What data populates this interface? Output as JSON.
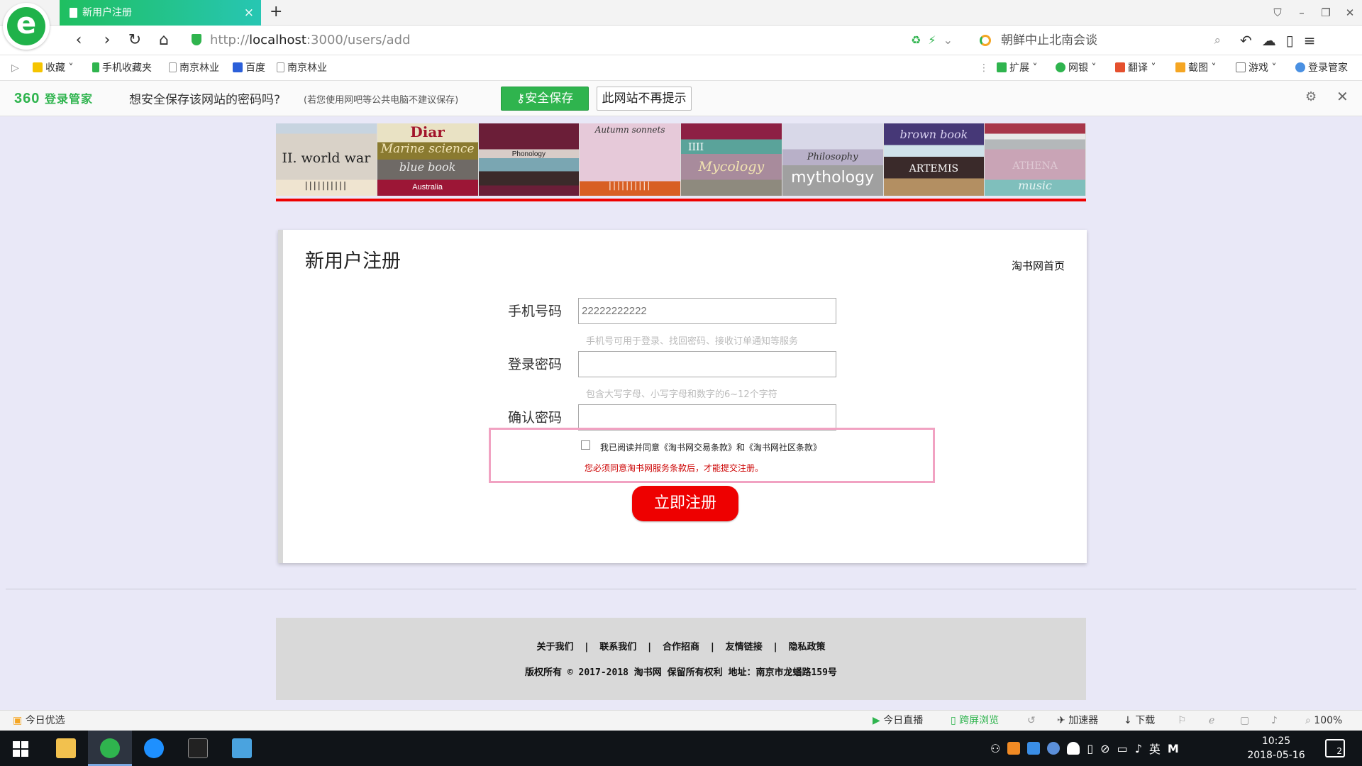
{
  "browser": {
    "tab_title": "新用户注册",
    "tab_close": "×",
    "new_tab": "+",
    "url_prefix": "http://",
    "url_host": "localhost",
    "url_rest": ":3000/users/add",
    "search_text": "朝鲜中止北南会谈",
    "zoom": "100%"
  },
  "favorites": {
    "items": [
      "收藏",
      "手机收藏夹",
      "南京林业",
      "百度",
      "南京林业"
    ],
    "right_items": [
      "扩展",
      "网银",
      "翻译",
      "截图",
      "游戏",
      "登录管家"
    ]
  },
  "password_bar": {
    "brand": "360",
    "brand_sub": "登录管家",
    "question": "想安全保存该网站的密码吗?",
    "note": "(若您使用网吧等公共电脑不建议保存)",
    "save_label": "安全保存",
    "never_label": "此网站不再提示"
  },
  "banner": {
    "books": [
      {
        "title": "II. world war",
        "sub": ""
      },
      {
        "title": "Diar",
        "sub": "Marine science"
      },
      {
        "title": "Phonology",
        "sub": ""
      },
      {
        "title": "Autumn sonnets",
        "sub": ""
      },
      {
        "title": "Mycology",
        "sub": "IIII"
      },
      {
        "title": "mythology",
        "sub": "Philosophy"
      },
      {
        "title": "ARTEMIS",
        "sub": "brown book"
      },
      {
        "title": "ATHENA",
        "sub": "music"
      }
    ],
    "extra": {
      "blue_book": "blue book",
      "australia": "Australia"
    }
  },
  "form": {
    "title": "新用户注册",
    "home_link": "淘书网首页",
    "phone_label": "手机号码",
    "phone_placeholder": "22222222222",
    "phone_hint": "手机号可用于登录、找回密码、接收订单通知等服务",
    "password_label": "登录密码",
    "password_hint": "包含大写字母、小写字母和数字的6~12个字符",
    "confirm_label": "确认密码",
    "terms_text": "我已阅读并同意《淘书网交易条款》和《淘书网社区条款》",
    "terms_error": "您必须同意淘书网服务条款后，才能提交注册。",
    "submit_label": "立即注册"
  },
  "footer": {
    "links": [
      "关于我们",
      "联系我们",
      "合作招商",
      "友情链接",
      "隐私政策"
    ],
    "separator": "|",
    "copyright": "版权所有 © 2017-2018 淘书网 保留所有权利 地址：南京市龙蟠路159号"
  },
  "statusbar": {
    "left": "今日优选",
    "live": "今日直播",
    "cross": "跨屏浏览",
    "accel": "加速器",
    "download": "下载",
    "zoom": "100%"
  },
  "taskbar": {
    "time": "10:25",
    "date": "2018-05-16",
    "ime": "英",
    "notifications": "2"
  },
  "colors": {
    "accent_green": "#2fb44e",
    "submit_red": "#ee0000",
    "page_bg": "#e9e8f7",
    "terms_border": "#f1a2c2"
  }
}
